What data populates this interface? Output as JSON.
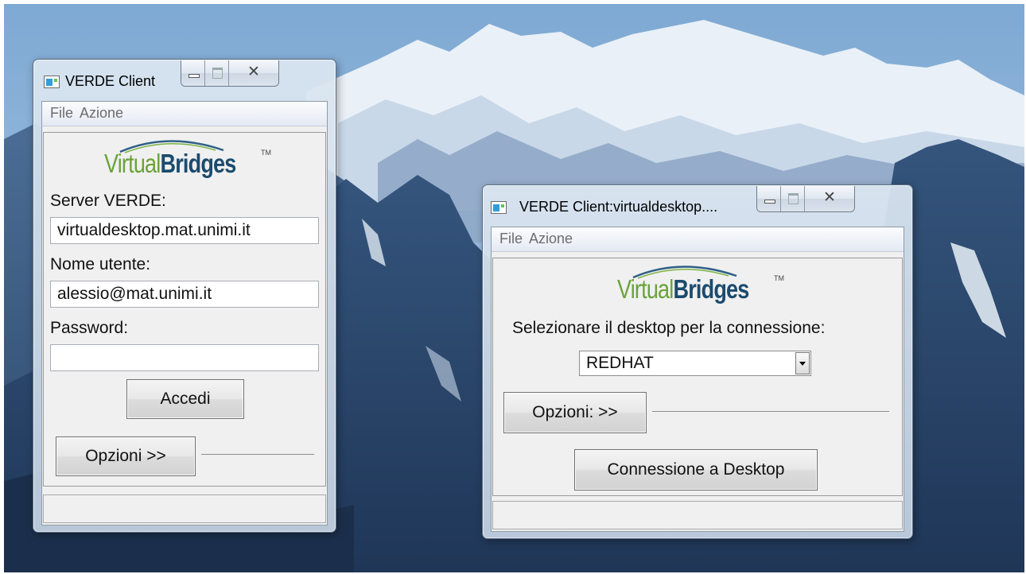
{
  "colors": {
    "logo_green": "#6aa23a",
    "logo_blue": "#1b4b6e",
    "menu_text": "#6d6d6d"
  },
  "login_window": {
    "title": "VERDE Client",
    "menu": [
      "File",
      "Azione"
    ],
    "logo": {
      "part1": "Virtual",
      "part2": "Bridges",
      "tm": "TM"
    },
    "server_label": "Server VERDE:",
    "server_value": "virtualdesktop.mat.unimi.it",
    "username_label": "Nome utente:",
    "username_value": "alessio@mat.unimi.it",
    "password_label": "Password:",
    "password_value": "",
    "login_button": "Accedi",
    "options_button": "Opzioni >>",
    "status_text": ""
  },
  "desktop_window": {
    "title": "VERDE Client:virtualdesktop....",
    "menu": [
      "File",
      "Azione"
    ],
    "logo": {
      "part1": "Virtual",
      "part2": "Bridges",
      "tm": "TM"
    },
    "prompt": "Selezionare il desktop per la connessione:",
    "desktop_selected": "REDHAT",
    "options_button": "Opzioni: >>",
    "connect_button": "Connessione a Desktop",
    "status_text": ""
  }
}
